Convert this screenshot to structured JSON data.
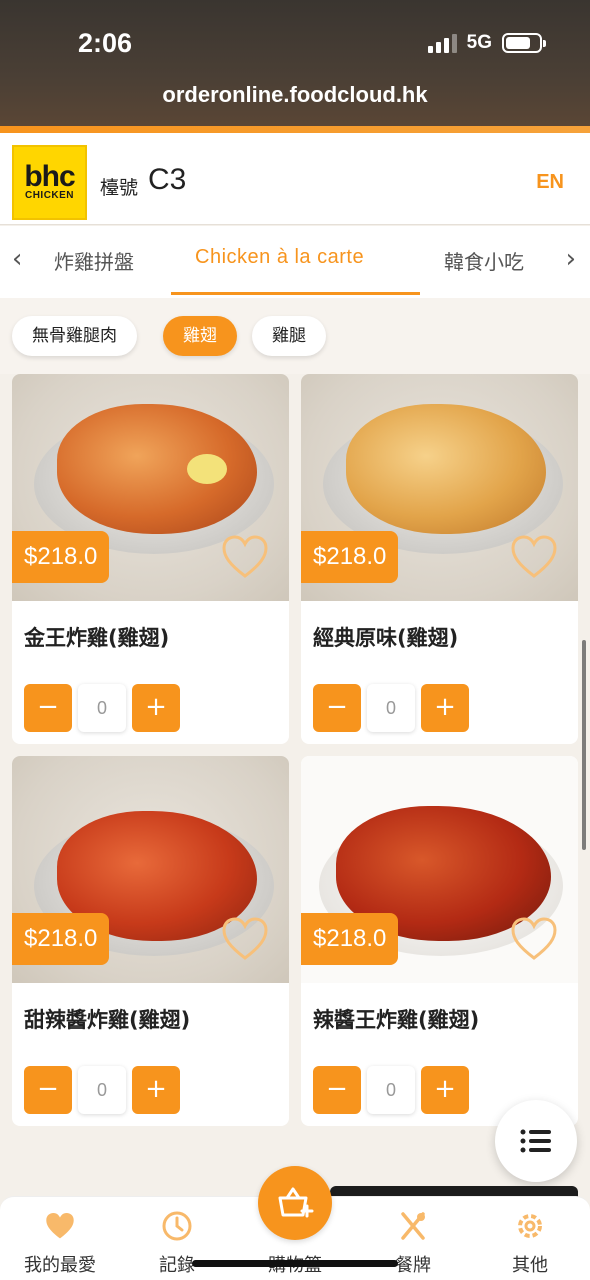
{
  "status_bar": {
    "time": "2:06",
    "network": "5G"
  },
  "browser": {
    "url": "orderonline.foodcloud.hk"
  },
  "header": {
    "logo_big": "bhc",
    "logo_small": "CHICKEN",
    "table_label": "檯號",
    "table_number": "C3",
    "language": "EN"
  },
  "category_tabs": [
    "炸雞拼盤",
    "Chicken à la carte",
    "韓食小吃"
  ],
  "sub_tabs": [
    "無骨雞腿肉",
    "雞翅",
    "雞腿"
  ],
  "products": [
    {
      "price": "$218.0",
      "name": "金王炸雞(雞翅)",
      "qty": "0"
    },
    {
      "price": "$218.0",
      "name": "經典原味(雞翅)",
      "qty": "0"
    },
    {
      "price": "$218.0",
      "name": "甜辣醬炸雞(雞翅)",
      "qty": "0"
    },
    {
      "price": "$218.0",
      "name": "辣醬王炸雞(雞翅)",
      "qty": "0"
    }
  ],
  "stepper": {
    "minus": "−",
    "plus": "+"
  },
  "bottom_nav": [
    "我的最愛",
    "記錄",
    "購物籃",
    "餐牌",
    "其他"
  ],
  "colors": {
    "accent": "#f7941d",
    "logo_yellow": "#ffd600"
  },
  "icons": {
    "nav": [
      "heart-icon",
      "clock-icon",
      "basket-icon",
      "utensils-icon",
      "gear-icon"
    ],
    "fab": "list-icon"
  }
}
